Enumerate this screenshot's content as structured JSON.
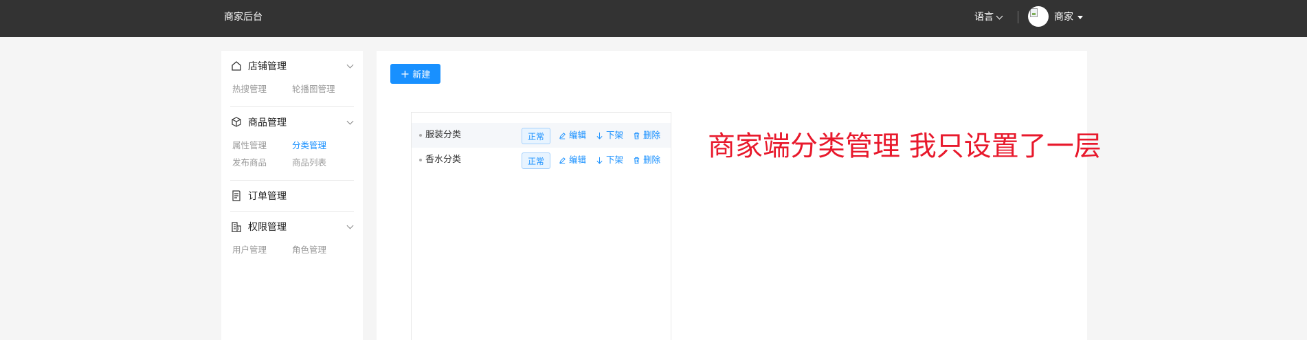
{
  "header": {
    "brand": "商家后台",
    "language_label": "语言",
    "user_name": "商家"
  },
  "sidebar": {
    "groups": [
      {
        "icon": "home-icon",
        "title": "店铺管理",
        "items": [
          "热搜管理",
          "轮播图管理"
        ]
      },
      {
        "icon": "box-icon",
        "title": "商品管理",
        "items": [
          "属性管理",
          "分类管理",
          "发布商品",
          "商品列表"
        ],
        "active": "分类管理"
      },
      {
        "icon": "order-icon",
        "title": "订单管理",
        "items": []
      },
      {
        "icon": "building-icon",
        "title": "权限管理",
        "items": [
          "用户管理",
          "角色管理"
        ]
      }
    ]
  },
  "toolbar": {
    "new_label": "新建"
  },
  "categories": [
    {
      "name": "服装分类",
      "status": "正常",
      "edit": "编辑",
      "offshelf": "下架",
      "delete": "删除"
    },
    {
      "name": "香水分类",
      "status": "正常",
      "edit": "编辑",
      "offshelf": "下架",
      "delete": "删除"
    }
  ],
  "annotation": "商家端分类管理 我只设置了一层",
  "colors": {
    "topbar": "#333333",
    "accent": "#1890ff",
    "annotation": "#e8192c"
  }
}
